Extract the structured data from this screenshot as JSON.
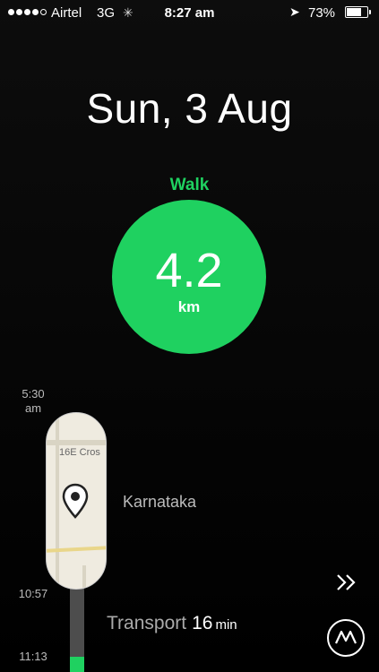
{
  "status_bar": {
    "carrier": "Airtel",
    "network": "3G",
    "time": "8:27 am",
    "battery_percent": "73%",
    "battery_level": 0.73,
    "signal_bars_filled": 4,
    "signal_bars_total": 5
  },
  "date": "Sun, 3 Aug",
  "activity": {
    "label": "Walk",
    "distance": "4.2",
    "unit": "km",
    "color": "#1fd160"
  },
  "timeline": {
    "start_time": "5:30 am",
    "transport_start_time": "10:57",
    "next_time": "11:13",
    "map_street_label": "16E Cros",
    "place_name": "Karnataka",
    "transport_label": "Transport",
    "transport_duration": "16",
    "transport_unit": "min"
  },
  "icons": {
    "forward": "double-chevron-right-icon",
    "logo": "moves-logo-icon",
    "pin": "location-pin-icon"
  }
}
